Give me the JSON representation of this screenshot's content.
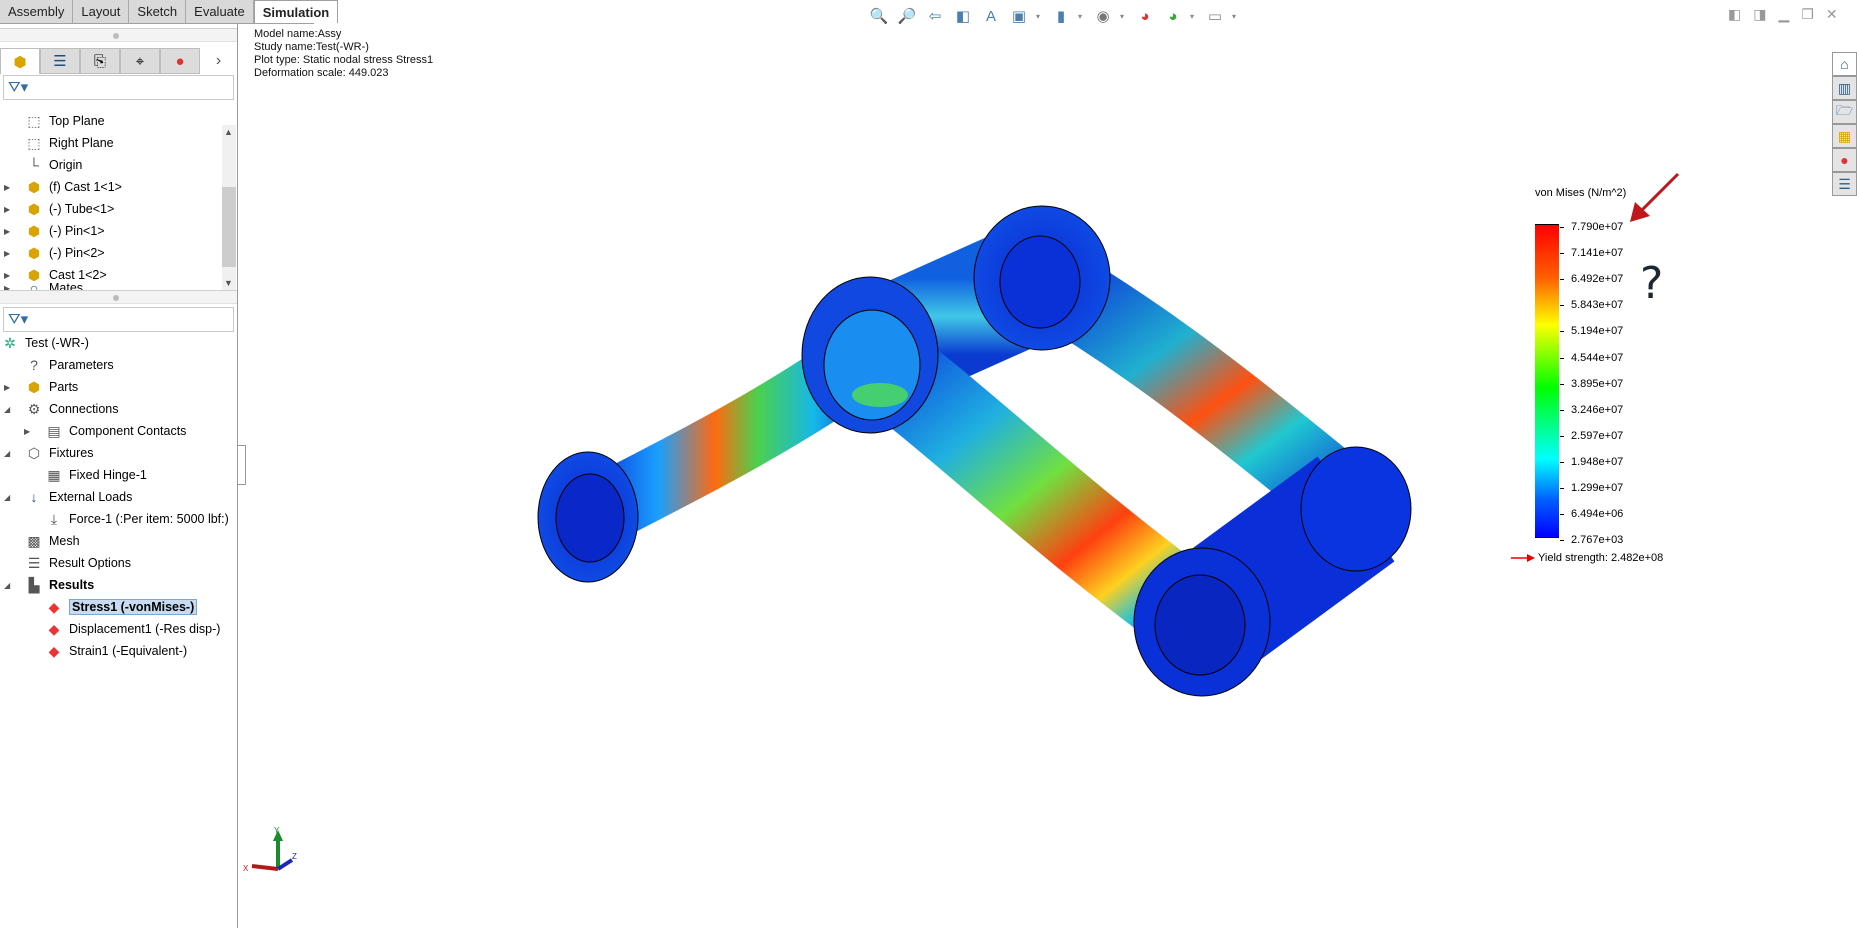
{
  "tabs": [
    "Assembly",
    "Layout",
    "Sketch",
    "Evaluate",
    "Simulation"
  ],
  "active_tab": "Simulation",
  "feature_tree": [
    {
      "label": "Top Plane",
      "icon": "plane-icon"
    },
    {
      "label": "Right Plane",
      "icon": "plane-icon"
    },
    {
      "label": "Origin",
      "icon": "origin-icon"
    },
    {
      "label": "(f) Cast 1<1>",
      "icon": "part-icon",
      "expandable": true
    },
    {
      "label": "(-) Tube<1>",
      "icon": "part-icon",
      "expandable": true
    },
    {
      "label": "(-) Pin<1>",
      "icon": "part-icon",
      "expandable": true
    },
    {
      "label": "(-) Pin<2>",
      "icon": "part-icon",
      "expandable": true
    },
    {
      "label": "Cast 1<2>",
      "icon": "part-icon",
      "expandable": true
    },
    {
      "label": "Mates",
      "icon": "mates-icon",
      "expandable": true
    }
  ],
  "sim_tree": [
    {
      "label": "Test (-WR-)",
      "level": 0,
      "icon": "study-icon"
    },
    {
      "label": "Parameters",
      "level": 1,
      "icon": "parameters-icon"
    },
    {
      "label": "Parts",
      "level": 1,
      "icon": "parts-icon",
      "toggle": "collapsed"
    },
    {
      "label": "Connections",
      "level": 1,
      "icon": "connections-icon",
      "toggle": "expanded"
    },
    {
      "label": "Component Contacts",
      "level": 2,
      "icon": "contacts-icon",
      "toggle": "collapsed"
    },
    {
      "label": "Fixtures",
      "level": 1,
      "icon": "fixtures-icon",
      "toggle": "expanded"
    },
    {
      "label": "Fixed Hinge-1",
      "level": 2,
      "icon": "hinge-icon"
    },
    {
      "label": "External Loads",
      "level": 1,
      "icon": "loads-icon",
      "toggle": "expanded"
    },
    {
      "label": "Force-1 (:Per item: 5000 lbf:)",
      "level": 2,
      "icon": "force-icon"
    },
    {
      "label": "Mesh",
      "level": 1,
      "icon": "mesh-icon"
    },
    {
      "label": "Result Options",
      "level": 1,
      "icon": "result-options-icon"
    },
    {
      "label": "Results",
      "level": 1,
      "icon": "results-folder-icon",
      "toggle": "expanded",
      "bold": true
    },
    {
      "label": "Stress1 (-vonMises-)",
      "level": 2,
      "icon": "stress-plot-icon",
      "selected": true
    },
    {
      "label": "Displacement1 (-Res disp-)",
      "level": 2,
      "icon": "displacement-plot-icon"
    },
    {
      "label": "Strain1 (-Equivalent-)",
      "level": 2,
      "icon": "strain-plot-icon"
    }
  ],
  "info": {
    "model": "Model name:Assy",
    "study": "Study name:Test(-WR-)",
    "plot": "Plot type: Static nodal stress Stress1",
    "deformation": "Deformation scale: 449.023"
  },
  "legend": {
    "title": "von Mises (N/m^2)",
    "labels": [
      "7.790e+07",
      "7.141e+07",
      "6.492e+07",
      "5.843e+07",
      "5.194e+07",
      "4.544e+07",
      "3.895e+07",
      "3.246e+07",
      "2.597e+07",
      "1.948e+07",
      "1.299e+07",
      "6.494e+06",
      "2.767e+03"
    ],
    "yield": "Yield strength: 2.482e+08",
    "annotation": "?"
  },
  "triad": {
    "x": "X",
    "y": "Y",
    "z": "Z"
  },
  "colors": {
    "max": "#ff0000",
    "min": "#0000ff",
    "selection": "#c7dcf2",
    "annotation_arrow": "#c0161c"
  }
}
